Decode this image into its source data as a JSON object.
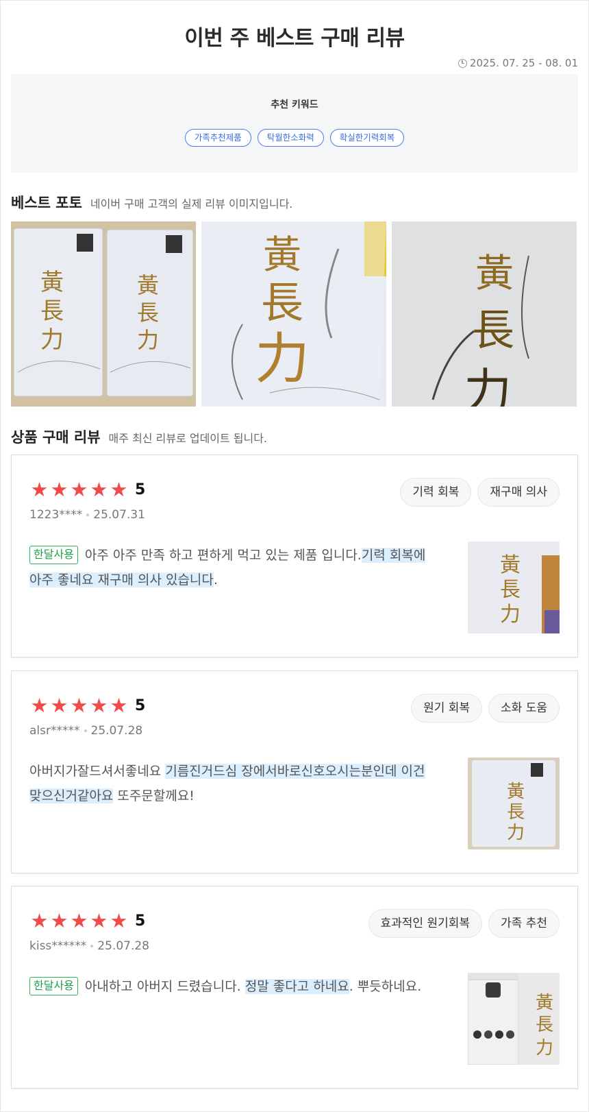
{
  "header": {
    "title": "이번 주 베스트 구매 리뷰",
    "date_range": "2025. 07. 25 - 08. 01"
  },
  "keywords": {
    "title": "추천 키워드",
    "tags": [
      "가족추천제품",
      "탁월한소화력",
      "확실한기력회복"
    ]
  },
  "best_photo": {
    "title": "베스트 포토",
    "subtitle": "네이버 구매 고객의 실제 리뷰 이미지입니다."
  },
  "reviews_section": {
    "title": "상품 구매 리뷰",
    "subtitle": "매주 최신 리뷰로 업데이트 됩니다."
  },
  "product_label": {
    "hanja": [
      "黃",
      "長",
      "力"
    ],
    "hangul": "황장력"
  },
  "colors": {
    "star": "#f04c4c",
    "badge_green": "#2db35a",
    "keyword_blue": "#3a6ee8",
    "highlight": "#dcefff",
    "gold": "#a2792b"
  },
  "reviews": [
    {
      "rating": 5,
      "stars": 5,
      "user": "1223****",
      "date": "25.07.31",
      "tags": [
        "기력 회복",
        "재구매 의사"
      ],
      "badge": "한달사용",
      "text_before": "아주 아주 만족 하고 편하게 먹고 있는 제품 입니다.",
      "text_highlight": "기력 회복에 아주 좋네요 재구매 의사 있습니다",
      "text_after": "."
    },
    {
      "rating": 5,
      "stars": 5,
      "user": "alsr*****",
      "date": "25.07.28",
      "tags": [
        "원기 회복",
        "소화 도움"
      ],
      "badge": "",
      "text_before": "아버지가잘드셔서좋네요 ",
      "text_highlight": "기름진거드심 장에서바로신호오시는분인데 이건맞으신거같아요",
      "text_after": " 또주문할께요!"
    },
    {
      "rating": 5,
      "stars": 5,
      "user": "kiss******",
      "date": "25.07.28",
      "tags": [
        "효과적인 원기회복",
        "가족 추천"
      ],
      "badge": "한달사용",
      "text_before": "아내하고 아버지 드렸습니다. ",
      "text_highlight": "정말 좋다고 하네요",
      "text_after": ". 뿌듯하네요."
    }
  ]
}
